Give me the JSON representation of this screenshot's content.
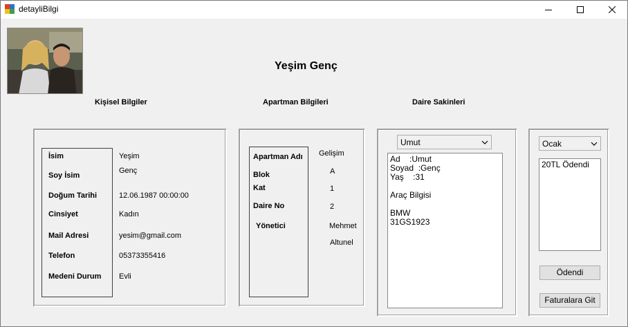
{
  "window": {
    "title": "detayliBilgi"
  },
  "header": {
    "name": "Yeşim Genç"
  },
  "sections": {
    "personal": "Kişisel Bilgiler",
    "apartment": "Apartman Bilgileri",
    "residents": "Daire Sakinleri"
  },
  "personal": {
    "labels": [
      "İsim",
      "Soy İsim",
      "Doğum Tarihi",
      "Cinsiyet",
      "Mail Adresi",
      "Telefon",
      "Medeni Durum"
    ],
    "values": [
      "Yeşim",
      "Genç",
      "12.06.1987 00:00:00",
      "Kadın",
      "yesim@gmail.com",
      "05373355416",
      "Evli"
    ]
  },
  "apartment": {
    "labels": [
      "Apartman Adı",
      "Blok",
      "Kat",
      "Daire No",
      "Yönetici"
    ],
    "values": [
      "Gelişim",
      "A",
      "1",
      "2",
      "Mehmet",
      "Altunel"
    ]
  },
  "residents": {
    "selected": "Umut",
    "details": [
      "Ad    :Umut",
      "Soyad  :Genç",
      "Yaş    :31",
      "",
      "Araç Bilgisi",
      "",
      "BMW",
      "31GS1923"
    ]
  },
  "payments": {
    "month_selected": "Ocak",
    "items": [
      "20TL Ödendi"
    ],
    "paid_button": "Ödendi",
    "invoices_button": "Faturalara Git"
  }
}
